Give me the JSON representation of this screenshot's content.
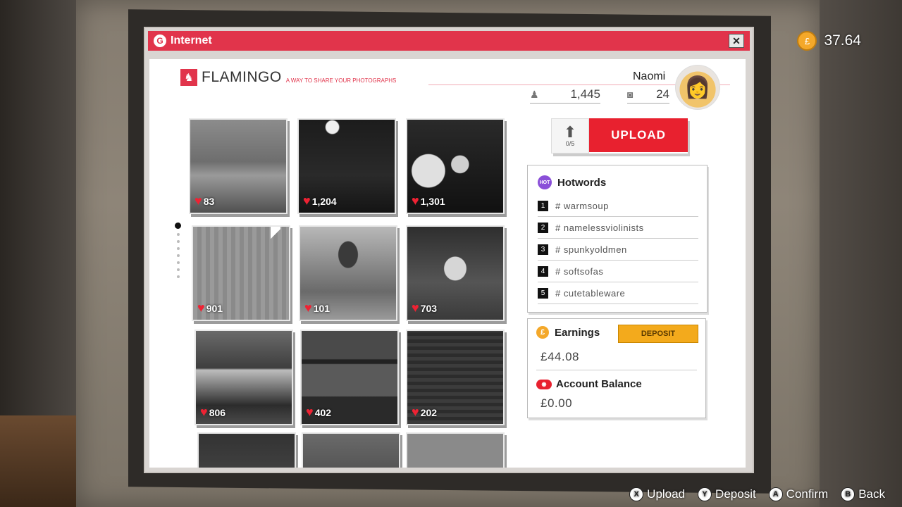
{
  "hud": {
    "currency_icon": "pound-coin-icon",
    "balance": "37.64"
  },
  "window": {
    "title": "Internet",
    "close_symbol": "✕"
  },
  "site": {
    "brand": "FLAMINGO",
    "tagline": "A WAY TO SHARE YOUR PHOTOGRAPHS",
    "user": {
      "name": "Naomi",
      "followers": "1,445",
      "photos": "24"
    }
  },
  "pagination": {
    "pages": 8,
    "current": 1
  },
  "photos": [
    {
      "likes": "83"
    },
    {
      "likes": "1,204"
    },
    {
      "likes": "1,301"
    },
    {
      "likes": "901"
    },
    {
      "likes": "101"
    },
    {
      "likes": "703"
    },
    {
      "likes": "806"
    },
    {
      "likes": "402"
    },
    {
      "likes": "202"
    },
    {
      "likes": ""
    },
    {
      "likes": ""
    },
    {
      "likes": ""
    }
  ],
  "upload": {
    "count": "0/5",
    "label": "UPLOAD"
  },
  "hotwords": {
    "title": "Hotwords",
    "badge": "HOT",
    "items": [
      {
        "rank": "1",
        "tag": "# warmsoup"
      },
      {
        "rank": "2",
        "tag": "# namelessviolinists"
      },
      {
        "rank": "3",
        "tag": "# spunkyoldmen"
      },
      {
        "rank": "4",
        "tag": "# softsofas"
      },
      {
        "rank": "5",
        "tag": "# cutetableware"
      }
    ]
  },
  "earnings": {
    "title": "Earnings",
    "amount": "£44.08",
    "deposit_label": "DEPOSIT",
    "balance_title": "Account Balance",
    "balance": "£0.00"
  },
  "controls": [
    {
      "key": "X",
      "label": "Upload"
    },
    {
      "key": "Y",
      "label": "Deposit"
    },
    {
      "key": "A",
      "label": "Confirm"
    },
    {
      "key": "B",
      "label": "Back"
    }
  ]
}
